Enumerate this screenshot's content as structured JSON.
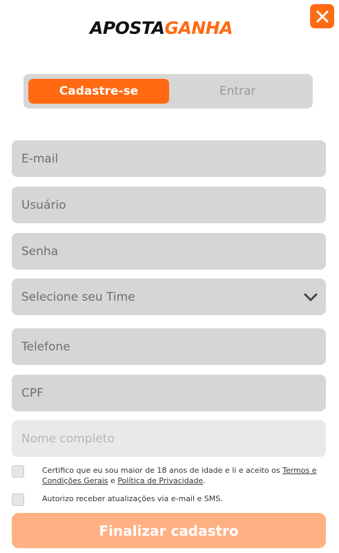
{
  "logo": {
    "part1": "APOSTA",
    "part2": "GANHA"
  },
  "close_icon": "close-icon",
  "tabs": {
    "signup": "Cadastre-se",
    "login": "Entrar"
  },
  "fields": {
    "email": "E-mail",
    "username": "Usuário",
    "password": "Senha",
    "team": "Selecione seu Time",
    "phone": "Telefone",
    "cpf": "CPF",
    "fullname": "Nome completo"
  },
  "consent": {
    "age_prefix": "Certifico que eu sou maior de 18 anos de idade e li e aceito os ",
    "terms_link": "Termos e Condições Gerais",
    "conj": " e ",
    "privacy_link": "Política de Privacidade",
    "period": ".",
    "updates": "Autorizo receber atualizações via e-mail e SMS."
  },
  "submit_label": "Finalizar cadastro",
  "colors": {
    "accent": "#ff6a13",
    "field_bg": "#d6d6d6",
    "submit_disabled": "#ffb184"
  }
}
